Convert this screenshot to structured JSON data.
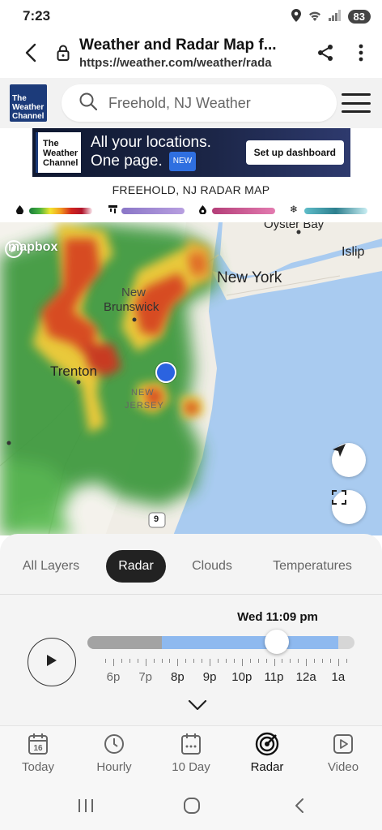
{
  "status_bar": {
    "time": "7:23",
    "battery": "83"
  },
  "browser": {
    "title": "Weather and Radar Map f...",
    "url": "https://weather.com/weather/rada"
  },
  "site_header": {
    "logo_text": "The Weather Channel",
    "search_placeholder": "Freehold, NJ Weather"
  },
  "ad": {
    "logo_text": "The Weather Channel",
    "line1": "All your locations.",
    "line2": "One page.",
    "badge": "NEW",
    "cta": "Set up dashboard"
  },
  "radar_heading": "FREEHOLD, NJ RADAR MAP",
  "legend": {
    "colors": {
      "rain": [
        "#1a7c3a",
        "#49b33f",
        "#f2e52f",
        "#f29a1f",
        "#d2261e",
        "#b0142a",
        "#fbe8ef"
      ],
      "mix": [
        "#8a76c7",
        "#b89fe0"
      ],
      "freezing": [
        "#b43e78",
        "#e37bb0"
      ],
      "snow": [
        "#5fbdc9",
        "#2d7f8e",
        "#c9eef3"
      ]
    }
  },
  "map": {
    "attribution": "mapbox",
    "labels": {
      "oyster_bay": "Oyster Bay",
      "islip": "Islip",
      "new_york": "New York",
      "new_brunswick_1": "New",
      "new_brunswick_2": "Brunswick",
      "trenton": "Trenton",
      "new_jersey_1": "NEW",
      "new_jersey_2": "JERSEY",
      "route_shield": "9"
    }
  },
  "layers": {
    "tabs": [
      "All Layers",
      "Radar",
      "Clouds",
      "Temperatures"
    ],
    "active": "Radar"
  },
  "timeline": {
    "current_time": "Wed 11:09 pm",
    "hours": [
      "6p",
      "7p",
      "8p",
      "9p",
      "10p",
      "11p",
      "12a",
      "1a"
    ],
    "played_fraction": 0.28,
    "position_fraction": 0.71,
    "future_end_fraction": 0.94
  },
  "bottom_nav": {
    "items": [
      "Today",
      "Hourly",
      "10 Day",
      "Radar",
      "Video"
    ],
    "active": "Radar",
    "today_date": "16"
  }
}
